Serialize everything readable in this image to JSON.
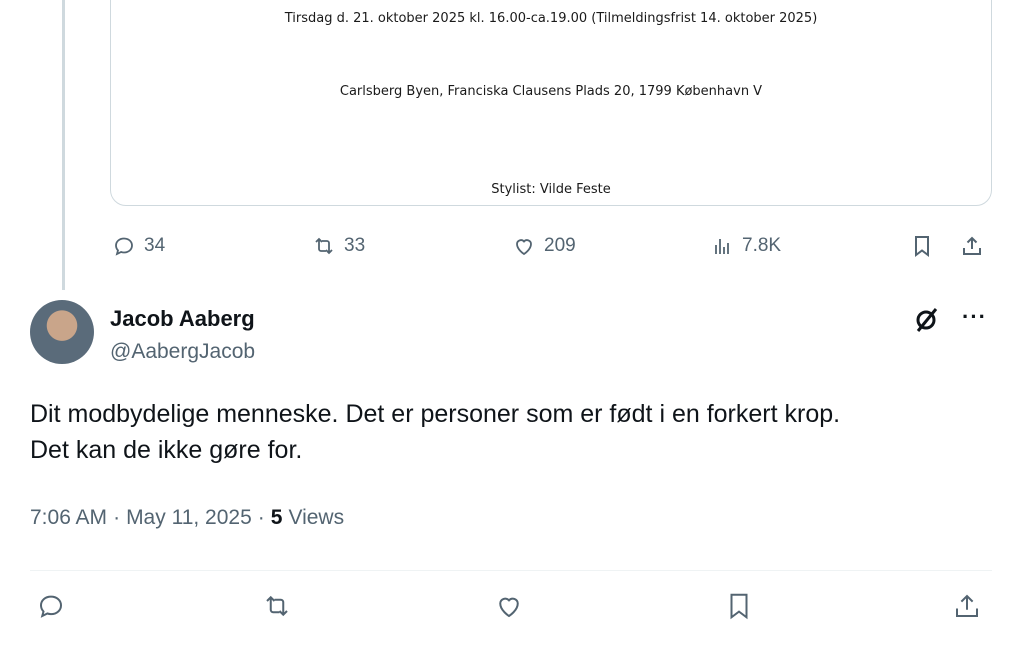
{
  "quoted_card": {
    "line1": "Tirsdag d. 21. oktober 2025 kl. 16.00-ca.19.00 (Tilmeldingsfrist 14. oktober 2025)",
    "line2": "Carlsberg Byen, Franciska Clausens Plads 20, 1799 København V",
    "line3": "Stylist: Vilde Feste"
  },
  "parent_actions": {
    "replies": "34",
    "reposts": "33",
    "likes": "209",
    "views": "7.8K"
  },
  "tweet": {
    "author_name": "Jacob Aaberg",
    "author_handle": "@AabergJacob",
    "text_line1": "Dit modbydelige menneske. Det er personer som er født i en forkert krop.",
    "text_line2": "Det kan de ikke gøre for.",
    "time": "7:06 AM",
    "date": "May 11, 2025",
    "views_count": "5",
    "views_label": "Views",
    "separator": "·",
    "more_glyph": "···"
  },
  "colors": {
    "text_primary": "#0f1419",
    "text_secondary": "#536471",
    "border": "#cfd9de"
  },
  "icons": [
    "reply-icon",
    "repost-icon",
    "like-icon",
    "views-icon",
    "bookmark-icon",
    "share-icon",
    "grok-icon",
    "more-icon"
  ]
}
